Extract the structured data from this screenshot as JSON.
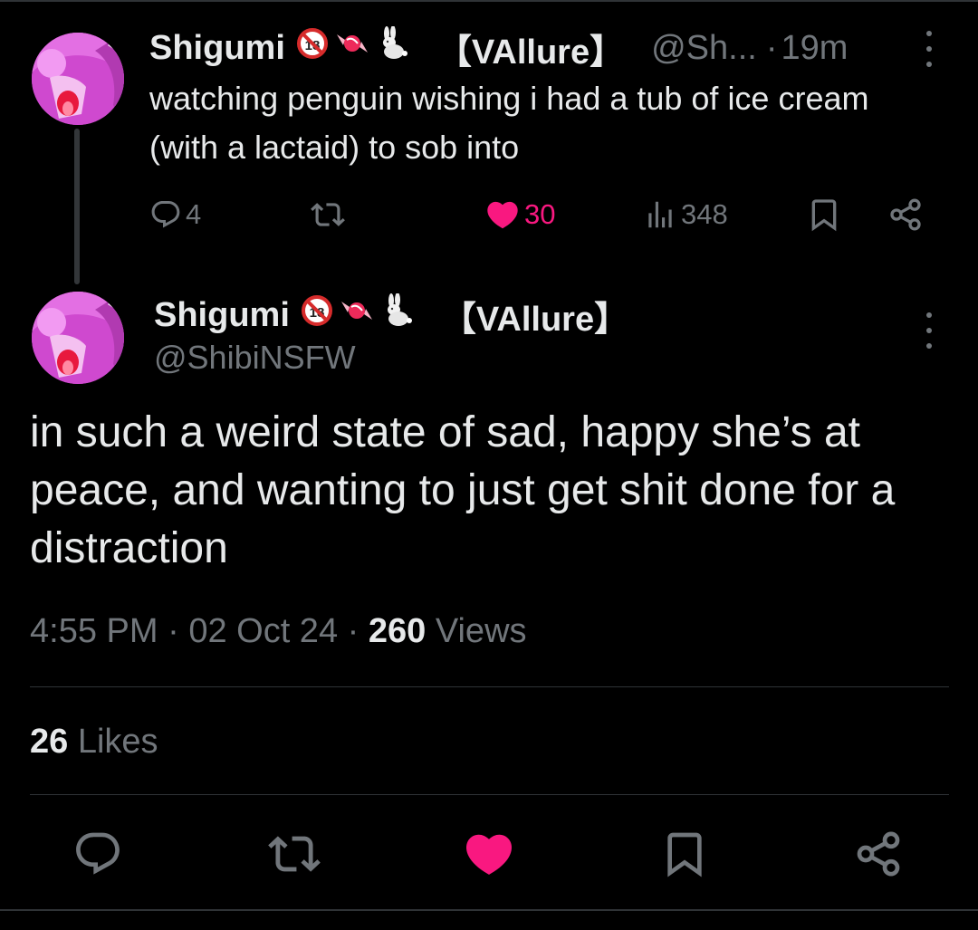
{
  "parent_tweet": {
    "display_name": "Shigumi",
    "emojis": [
      "no-under-18-emoji",
      "candy-emoji",
      "rabbit-emoji"
    ],
    "tag": "【VAllure】",
    "handle": "@Sh...",
    "separator": "·",
    "time_ago": "19m",
    "text": "watching penguin wishing i had a tub of ice cream (with a lactaid) to sob into",
    "replies": "4",
    "reposts": "",
    "likes": "30",
    "views": "348",
    "like_color": "#f91880"
  },
  "main_tweet": {
    "display_name": "Shigumi",
    "emojis": [
      "no-under-18-emoji",
      "candy-emoji",
      "rabbit-emoji"
    ],
    "tag": "【VAllure】",
    "handle": "@ShibiNSFW",
    "text": "in such a weird state of sad, happy she’s at peace, and wanting to just get shit done for a distraction",
    "time": "4:55 PM",
    "sep1": "·",
    "date": "02 Oct 24",
    "sep2": "·",
    "views_count": "260",
    "views_label": "Views",
    "likes_count": "26",
    "likes_label": "Likes"
  },
  "colors": {
    "background": "#000000",
    "text": "#e7e9ea",
    "muted": "#71767b",
    "like_pink": "#f91880",
    "divider": "#2f3336"
  }
}
